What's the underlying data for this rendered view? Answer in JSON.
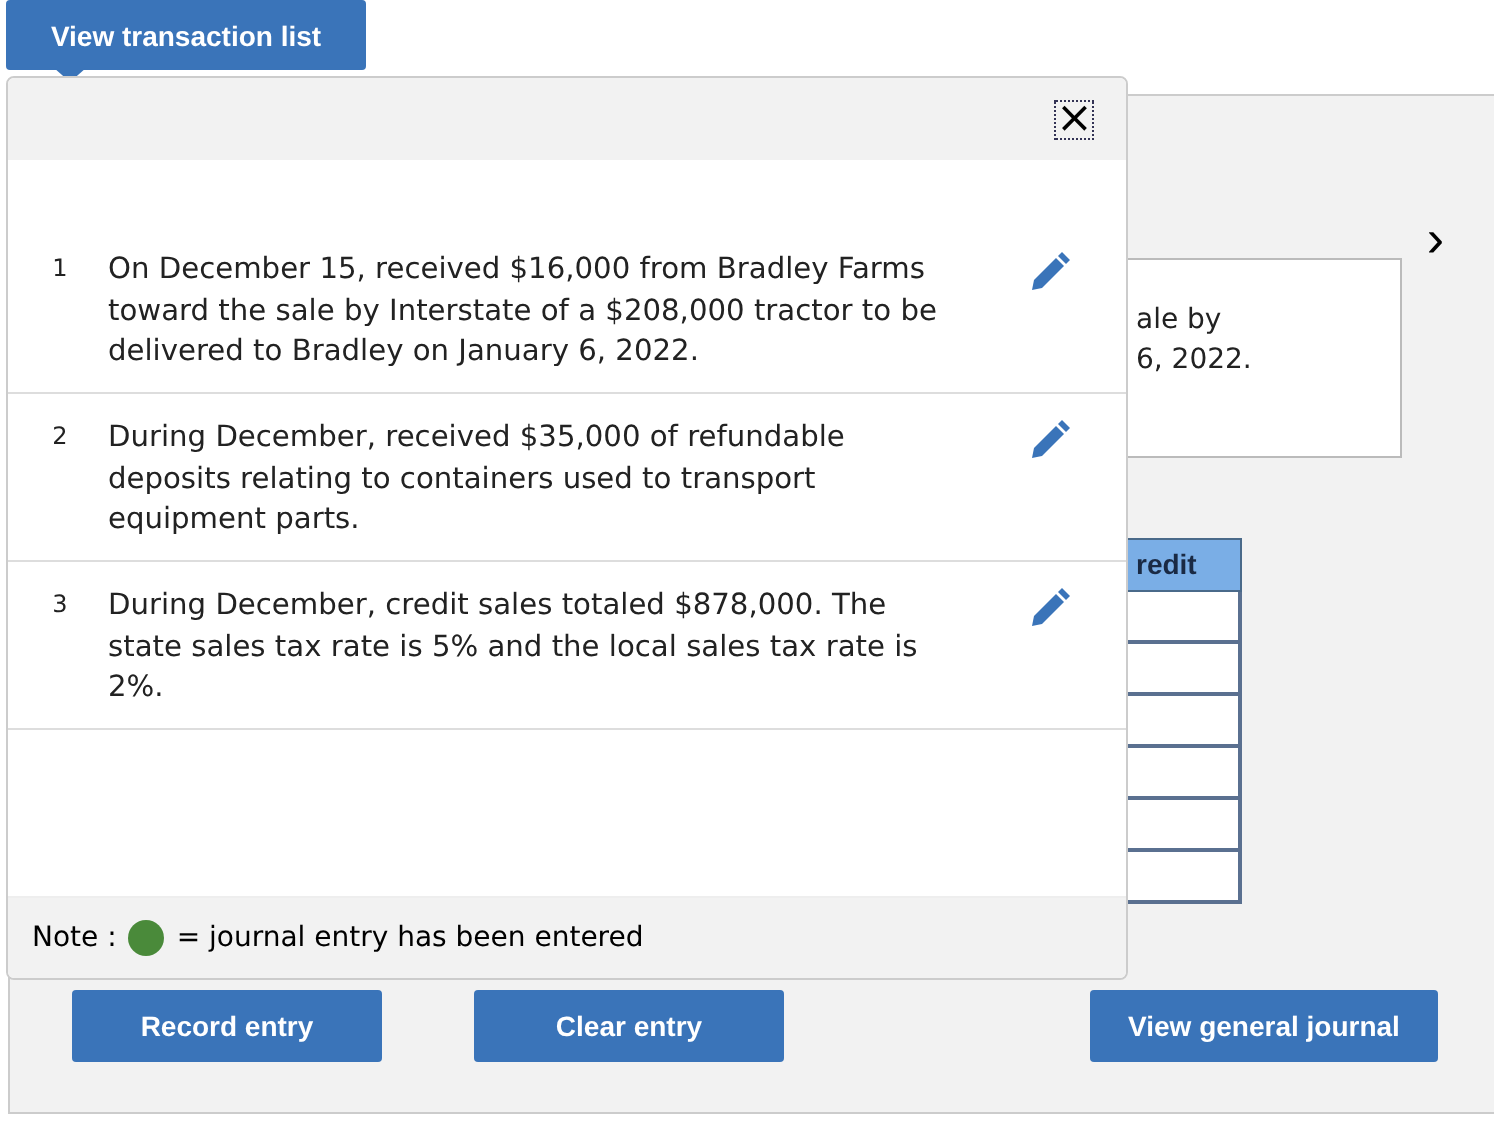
{
  "toolbar_button": "View transaction list",
  "popup": {
    "close": "×",
    "transactions": [
      {
        "number": "1",
        "text": "On December 15, received $16,000 from Bradley Farms toward the sale by Interstate of a $208,000 tractor to be delivered to Bradley on January 6, 2022."
      },
      {
        "number": "2",
        "text": "During December, received $35,000 of refundable deposits relating to containers used to transport equipment parts."
      },
      {
        "number": "3",
        "text": "During December, credit sales totaled $878,000. The state sales tax rate is 5% and the local sales tax rate is 2%."
      }
    ],
    "note": {
      "label": "Note :",
      "text": "= journal entry has been entered"
    }
  },
  "background": {
    "next": "›",
    "description_lines": [
      "ale by",
      "6, 2022."
    ],
    "table_header": "redit"
  },
  "buttons": [
    "Record entry",
    "Clear entry",
    "View general journal"
  ]
}
